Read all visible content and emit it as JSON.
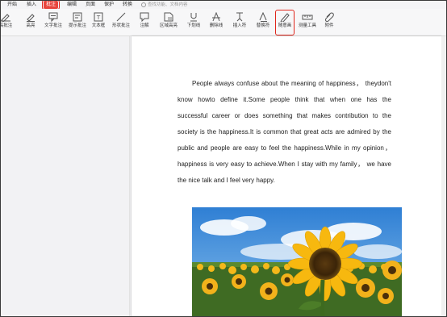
{
  "menubar": {
    "items": [
      {
        "label": "开始",
        "active": false
      },
      {
        "label": "插入",
        "active": false
      },
      {
        "label": "批注",
        "active": true
      },
      {
        "label": "编辑",
        "active": false
      },
      {
        "label": "页面",
        "active": false
      },
      {
        "label": "保护",
        "active": false
      },
      {
        "label": "转换",
        "active": false
      }
    ],
    "search_placeholder": "查找功能、文档内容"
  },
  "toolbar": {
    "tools": [
      {
        "label": "高批注",
        "icon": "highlight-comment-icon"
      },
      {
        "label": "高亮",
        "icon": "highlight-icon"
      },
      {
        "label": "文字批注",
        "icon": "text-comment-icon"
      },
      {
        "label": "提示批注",
        "icon": "note-comment-icon"
      },
      {
        "label": "文本框",
        "icon": "textbox-icon"
      },
      {
        "label": "形状批注",
        "icon": "shape-comment-icon"
      },
      {
        "label": "注解",
        "icon": "annotation-icon"
      },
      {
        "label": "区域高亮",
        "icon": "area-highlight-icon"
      },
      {
        "label": "下划线",
        "icon": "underline-icon"
      },
      {
        "label": "删除线",
        "icon": "strikethrough-icon"
      },
      {
        "label": "插入符",
        "icon": "insert-caret-icon"
      },
      {
        "label": "替换符",
        "icon": "replace-caret-icon"
      },
      {
        "label": "随意画",
        "icon": "pencil-icon"
      },
      {
        "label": "测量工具",
        "icon": "ruler-icon"
      },
      {
        "label": "附件",
        "icon": "paperclip-icon"
      }
    ]
  },
  "document": {
    "lines": [
      "People always confuse about the meaning of happiness， theydon't",
      "know howto define it.Some people think that when one has the",
      "successful career or does something that makes contribution to the",
      "society is the happiness.It is common that great acts are admired by the",
      "public and people are easy to feel the happiness.While in my opinion，",
      "happiness is very easy to achieve.When I stay with my family， we have",
      "the nice talk and I feel very happy."
    ],
    "image": "sunflower-field-photo"
  },
  "colors": {
    "accent_red": "#e0251b",
    "toolbar_bg": "#f7f7f8",
    "page_bg": "#ffffff"
  }
}
